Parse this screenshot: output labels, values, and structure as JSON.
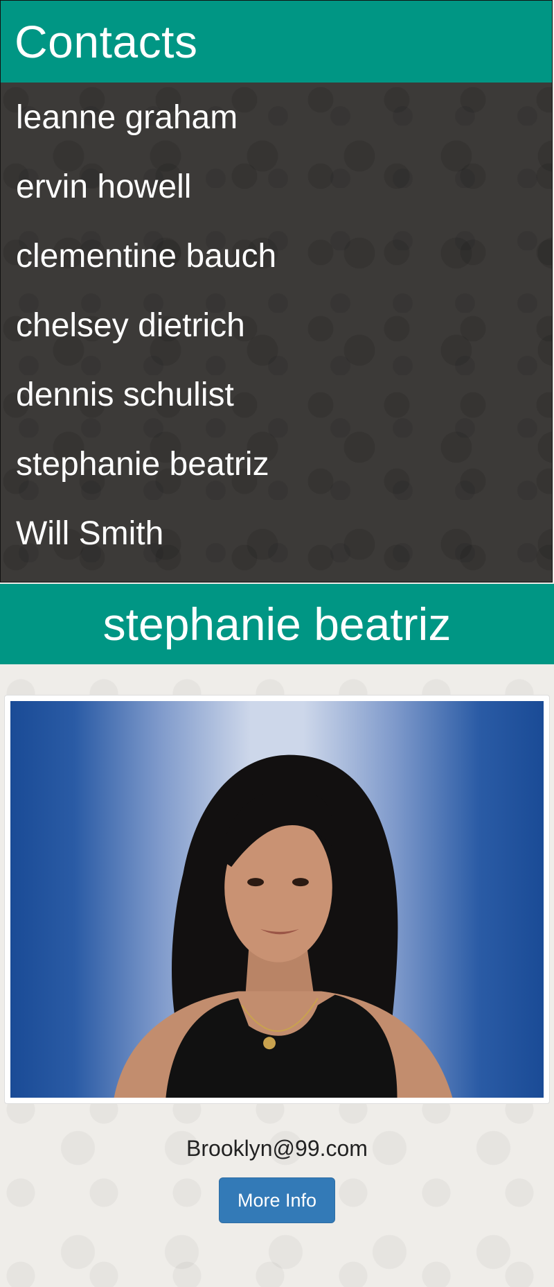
{
  "contacts": {
    "title": "Contacts",
    "items": [
      {
        "label": "leanne graham"
      },
      {
        "label": "ervin howell"
      },
      {
        "label": "clementine bauch"
      },
      {
        "label": "chelsey dietrich"
      },
      {
        "label": "dennis schulist"
      },
      {
        "label": "stephanie beatriz"
      },
      {
        "label": "Will Smith"
      }
    ]
  },
  "detail": {
    "name": "stephanie beatriz",
    "email": "Brooklyn@99.com",
    "more_info_label": "More Info"
  },
  "colors": {
    "header_teal": "#009684",
    "list_background": "#3c3a38",
    "button_blue": "#337ab7",
    "page_background": "#efede9"
  }
}
